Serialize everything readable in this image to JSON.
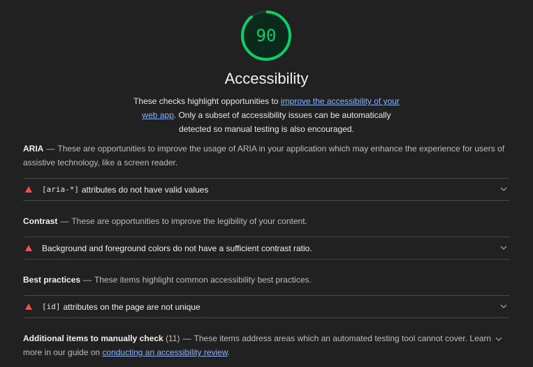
{
  "score": {
    "value": "90",
    "fraction": 0.9,
    "color": "#0cce6b"
  },
  "title": "Accessibility",
  "description": {
    "before": "These checks highlight opportunities to ",
    "link": "improve the accessibility of your web app",
    "after": ". Only a subset of accessibility issues can be automatically detected so manual testing is also encouraged."
  },
  "groups": [
    {
      "name": "ARIA",
      "dash": "—",
      "description": "These are opportunities to improve the usage of ARIA in your application which may enhance the experience for users of assistive technology, like a screen reader.",
      "audit": {
        "code": "[aria-*]",
        "text": "attributes do not have valid values",
        "status": "fail"
      }
    },
    {
      "name": "Contrast",
      "dash": "—",
      "description": "These are opportunities to improve the legibility of your content.",
      "audit": {
        "code": "",
        "text": "Background and foreground colors do not have a sufficient contrast ratio.",
        "status": "fail"
      }
    },
    {
      "name": "Best practices",
      "dash": "—",
      "description": "These items highlight common accessibility best practices.",
      "audit": {
        "code": "[id]",
        "text": "attributes on the page are not unique",
        "status": "fail"
      }
    }
  ],
  "manual": {
    "name": "Additional items to manually check",
    "count": "(11)",
    "dash": "—",
    "description": "These items address areas which an automated testing tool cannot cover. Learn more in our guide on ",
    "link": "conducting an accessibility review",
    "end": "."
  },
  "icons": {
    "fail": "red-triangle-icon",
    "expand": "chevron-down-icon"
  }
}
